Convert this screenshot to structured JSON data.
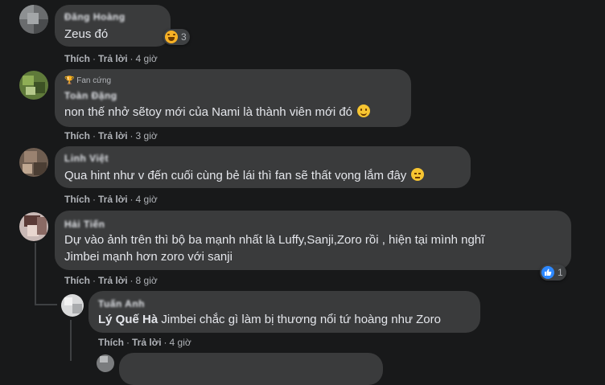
{
  "comments": [
    {
      "author_blurred": "Đăng Hoàng",
      "text": "Zeus đó",
      "reaction": {
        "emoji": "laughing-emoji",
        "count": "3"
      },
      "actions": {
        "like": "Thích",
        "reply": "Trả lời",
        "time": "4 giờ"
      }
    },
    {
      "badge": "Fan cứng",
      "author_blurred": "Toàn Đặng",
      "text": "non thế nhở sẽtoy mới của Nami là thành viên mới đó",
      "emoji": "smile-emoji",
      "actions": {
        "like": "Thích",
        "reply": "Trả lời",
        "time": "3 giờ"
      }
    },
    {
      "author_blurred": "Linh Việt",
      "text": "Qua hint như v đến cuối cùng bẻ lái thì fan sẽ thất vọng lắm đây",
      "emoji": "sad-emoji",
      "actions": {
        "like": "Thích",
        "reply": "Trả lời",
        "time": "4 giờ"
      }
    },
    {
      "author_blurred": "Hải Tiến",
      "text_line1": "Dự vào ảnh trên thì bộ ba mạnh nhất là Luffy,Sanji,Zoro rồi , hiện tại mình nghĩ",
      "text_line2": "Jimbei mạnh hơn zoro với sanji",
      "reaction": {
        "emoji": "like-icon",
        "count": "1"
      },
      "actions": {
        "like": "Thích",
        "reply": "Trả lời",
        "time": "8 giờ"
      }
    }
  ],
  "reply": {
    "author_blurred": "Tuấn Anh",
    "mention": "Lý Quế Hà",
    "text": " Jimbei chắc gì làm bị thương nổi tứ hoàng như Zoro",
    "actions": {
      "like": "Thích",
      "reply": "Trả lời",
      "time": "4 giờ"
    }
  },
  "separator": "·",
  "colors": {
    "background": "#18191a",
    "bubble": "#3a3b3c",
    "text": "#e4e6eb",
    "muted": "#b0b3b8",
    "like_blue": "#2d88ff"
  }
}
